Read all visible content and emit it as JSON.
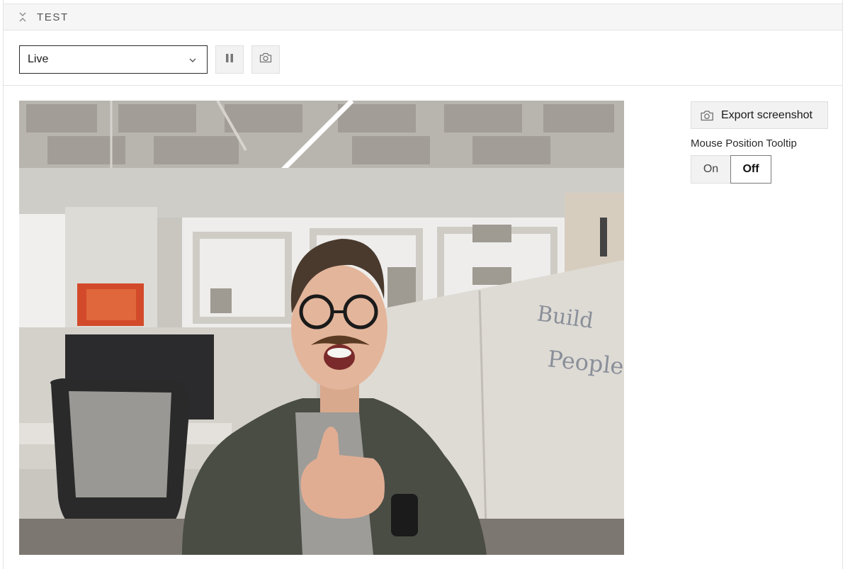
{
  "panel": {
    "title": "TEST",
    "collapse_icon": "collapse-chevrons-icon"
  },
  "toolbar": {
    "source_select": {
      "selected": "Live",
      "icon": "chevron-down-icon"
    },
    "pause_icon": "pause-icon",
    "snapshot_icon": "camera-icon"
  },
  "viewer": {
    "feed": "live camera feed"
  },
  "sidebar": {
    "export_label": "Export screenshot",
    "export_icon": "camera-icon",
    "tooltip_label": "Mouse Position Tooltip",
    "toggle": {
      "on_label": "On",
      "off_label": "Off",
      "selected": "Off"
    }
  },
  "colors": {
    "header_bg": "#f6f6f6",
    "button_bg": "#f2f2f2",
    "border": "#e3e3e3"
  }
}
